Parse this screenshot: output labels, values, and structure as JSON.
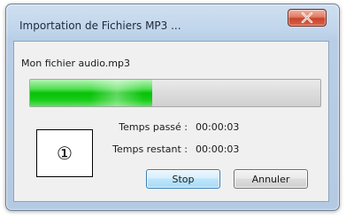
{
  "window": {
    "title": "Importation de Fichiers MP3 ...",
    "close_icon": "close-x-icon"
  },
  "file": {
    "name": "Mon fichier audio.mp3"
  },
  "progress": {
    "fraction": 0.42
  },
  "marker": {
    "label": "①"
  },
  "stats": {
    "elapsed_label": "Temps passé :",
    "elapsed_value": "00:00:03",
    "remaining_label": "Temps restant :",
    "remaining_value": "00:00:03"
  },
  "buttons": {
    "stop_label": "Stop",
    "cancel_label": "Annuler"
  },
  "colors": {
    "progress_green": "#08c108",
    "close_red": "#c9442a",
    "focus_blue": "#3c7fb1"
  }
}
